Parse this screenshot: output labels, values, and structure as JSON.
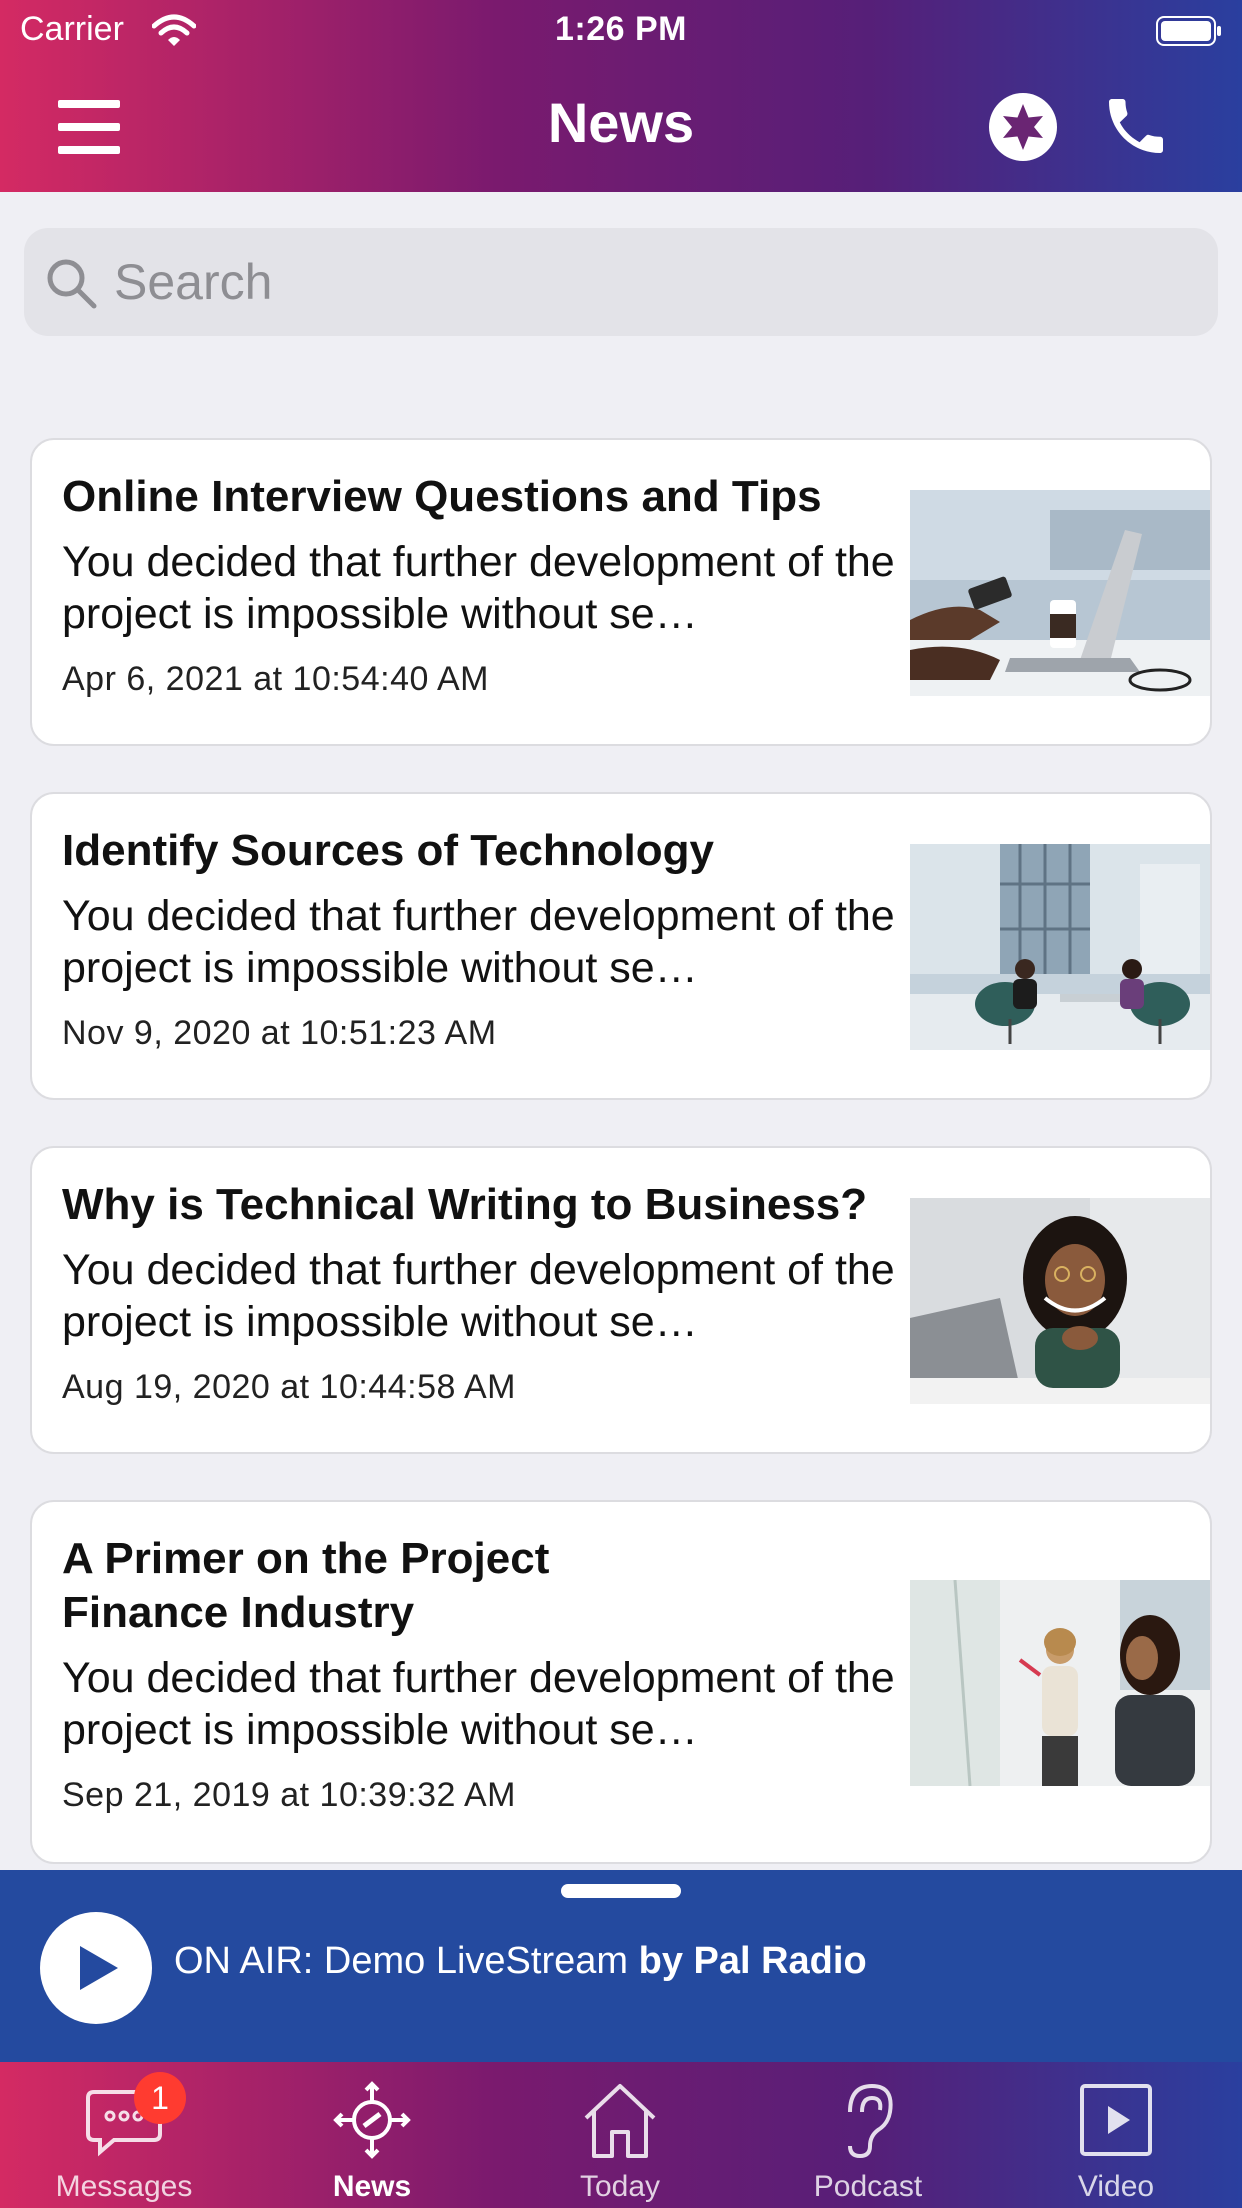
{
  "status_bar": {
    "carrier": "Carrier",
    "time": "1:26 PM"
  },
  "nav": {
    "title": "News"
  },
  "search": {
    "placeholder": "Search",
    "value": ""
  },
  "articles": [
    {
      "title": "Online Interview Questions and Tips",
      "description": "You decided that further development of the project is impossible without se…",
      "date": "Apr 6, 2021 at 10:54:40 AM",
      "image": "laptop-coffee-photo"
    },
    {
      "title": "Identify Sources of Technology",
      "description": "You decided that further development of the project is impossible without se…",
      "date": "Nov 9, 2020 at 10:51:23 AM",
      "image": "office-meeting-photo"
    },
    {
      "title": "Why is Technical Writing to Business?",
      "description": "You decided that further development of the project is impossible without se…",
      "date": "Aug 19, 2020 at 10:44:58 AM",
      "image": "smiling-woman-photo"
    },
    {
      "title": "A Primer on the Project Finance Industry",
      "description": "You decided that further development of the project is impossible without se…",
      "date": "Sep 21, 2019 at 10:39:32 AM",
      "image": "whiteboard-meeting-photo"
    }
  ],
  "player": {
    "on_air": "ON AIR: Demo LiveStream",
    "by": "by Pal Radio"
  },
  "tabs": [
    {
      "label": "Messages",
      "icon": "messages-icon",
      "badge": "1",
      "active": false
    },
    {
      "label": "News",
      "icon": "news-icon",
      "active": true
    },
    {
      "label": "Today",
      "icon": "home-icon",
      "active": false
    },
    {
      "label": "Podcast",
      "icon": "ear-icon",
      "active": false
    },
    {
      "label": "Video",
      "icon": "video-icon",
      "active": false
    }
  ],
  "colors": {
    "header_gradient_start": "#d42a63",
    "header_gradient_end": "#2a3f9f",
    "player_background": "#244a9f",
    "badge": "#ff3b30",
    "page_background": "#efeff4"
  }
}
